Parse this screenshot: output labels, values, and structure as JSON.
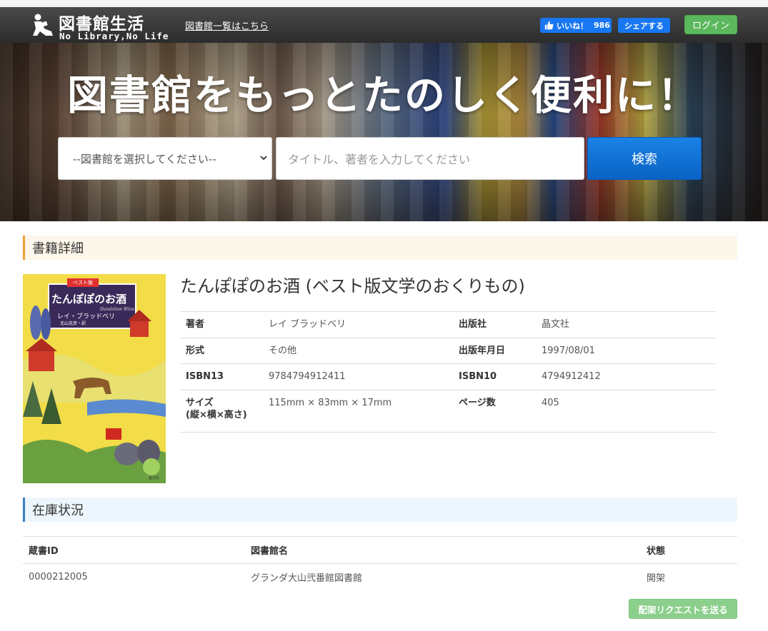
{
  "header": {
    "logo_title": "図書館生活",
    "logo_subtitle": "No Library,No Life",
    "library_list_link": "図書館一覧はこちら",
    "fb_like_label": "いいね！",
    "fb_like_count": "986",
    "fb_share_label": "シェアする",
    "login_label": "ログイン"
  },
  "hero": {
    "headline": "図書館をもっとたのしく便利に！",
    "library_select_value": "--図書館を選択してください--",
    "search_placeholder": "タイトル、著者を入力してください",
    "search_button": "検索"
  },
  "detail": {
    "section_title": "書籍詳細",
    "book_title": "たんぽぽのお酒 (ベスト版文学のおくりもの)",
    "cover": {
      "badge": "ベスト版",
      "title": "たんぽぽのお酒",
      "author": "レイ・ブラッドベリ",
      "translator": "北山克彦・訳",
      "english_title": "Dandelion Wine",
      "publisher_mark": "晶文社"
    },
    "rows": [
      {
        "k1": "著者",
        "v1": "レイ ブラッドベリ",
        "k2": "出版社",
        "v2": "晶文社"
      },
      {
        "k1": "形式",
        "v1": "その他",
        "k2": "出版年月日",
        "v2": "1997/08/01"
      },
      {
        "k1": "ISBN13",
        "v1": "9784794912411",
        "k2": "ISBN10",
        "v2": "4794912412"
      },
      {
        "k1": "サイズ",
        "k1b": "(縦×横×高さ)",
        "v1": "115mm × 83mm × 17mm",
        "k2": "ページ数",
        "v2": "405"
      }
    ]
  },
  "stock": {
    "section_title": "在庫状況",
    "columns": [
      "蔵書ID",
      "図書館名",
      "状態"
    ],
    "rows": [
      {
        "id": "0000212005",
        "library": "グランダ大山弐番館図書館",
        "status": "開架"
      }
    ],
    "request_button": "配架リクエストを送る"
  },
  "colors": {
    "detail_accent": "#f0a030",
    "stock_accent": "#3a7cc0",
    "search_button": "#0a62c4",
    "login_button": "#5cb85c",
    "facebook": "#1877f2"
  }
}
